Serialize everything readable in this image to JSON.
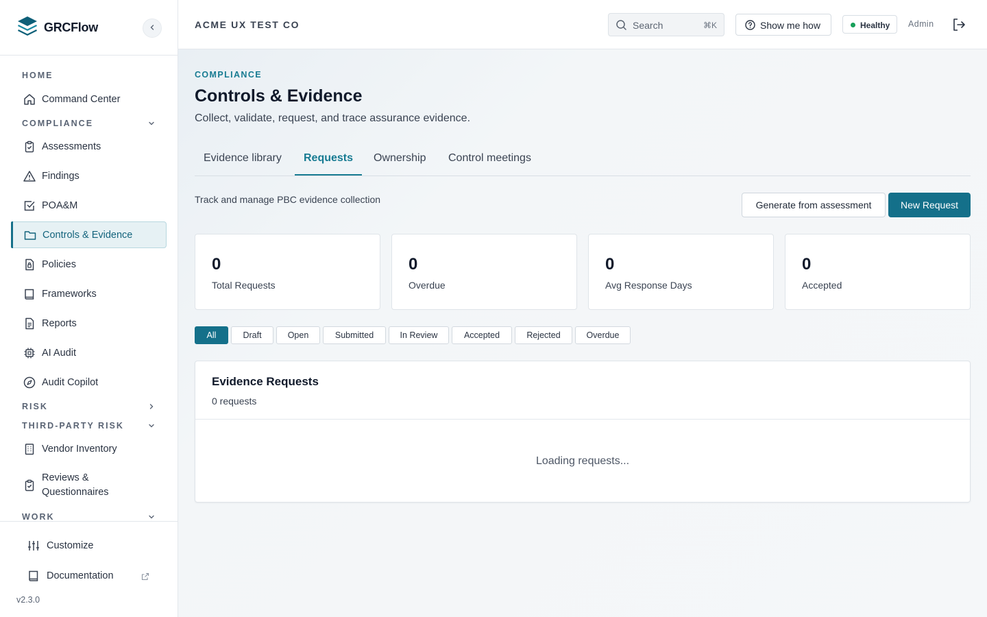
{
  "brand": {
    "name": "GRCFlow"
  },
  "sidebar": {
    "sections": {
      "home": "HOME",
      "compliance": "COMPLIANCE",
      "risk": "RISK",
      "third_party": "THIRD-PARTY RISK",
      "work": "WORK"
    },
    "items": [
      {
        "label": "Command Center",
        "icon": "home-icon"
      },
      {
        "label": "Assessments",
        "icon": "clipboard-check-icon"
      },
      {
        "label": "Findings",
        "icon": "warning-triangle-icon"
      },
      {
        "label": "POA&M",
        "icon": "checkbox-icon"
      },
      {
        "label": "Controls & Evidence",
        "icon": "folder-icon",
        "active": true
      },
      {
        "label": "Policies",
        "icon": "policy-document-icon"
      },
      {
        "label": "Frameworks",
        "icon": "book-icon"
      },
      {
        "label": "Reports",
        "icon": "report-icon"
      },
      {
        "label": "AI Audit",
        "icon": "chip-icon"
      },
      {
        "label": "Audit Copilot",
        "icon": "compass-icon"
      },
      {
        "label": "Vendor Inventory",
        "icon": "building-icon"
      },
      {
        "label": "Reviews & Questionnaires",
        "icon": "clipboard-check-icon"
      }
    ],
    "footer": {
      "customize": "Customize",
      "documentation": "Documentation",
      "version": "v2.3.0"
    }
  },
  "topbar": {
    "org": "ACME UX TEST CO",
    "search_placeholder": "Search",
    "search_shortcut": "⌘K",
    "howto": "Show me how",
    "health": "Healthy",
    "user": "Admin"
  },
  "page": {
    "eyebrow": "COMPLIANCE",
    "title": "Controls & Evidence",
    "subtitle": "Collect, validate, request, and trace assurance evidence.",
    "tabs": [
      "Evidence library",
      "Requests",
      "Ownership",
      "Control meetings"
    ],
    "active_tab": "Requests",
    "requests_note": "Track and manage PBC evidence collection",
    "generate_button": "Generate from assessment",
    "new_button": "New Request",
    "stats": [
      {
        "value": "0",
        "label": "Total Requests"
      },
      {
        "value": "0",
        "label": "Overdue"
      },
      {
        "value": "0",
        "label": "Avg Response Days"
      },
      {
        "value": "0",
        "label": "Accepted"
      }
    ],
    "filters": [
      "All",
      "Draft",
      "Open",
      "Submitted",
      "In Review",
      "Accepted",
      "Rejected",
      "Overdue"
    ],
    "active_filter": "All",
    "panel": {
      "title": "Evidence Requests",
      "count": "0 requests",
      "loading": "Loading requests..."
    }
  },
  "colors": {
    "accent": "#14708a",
    "healthy": "#18a05a"
  }
}
